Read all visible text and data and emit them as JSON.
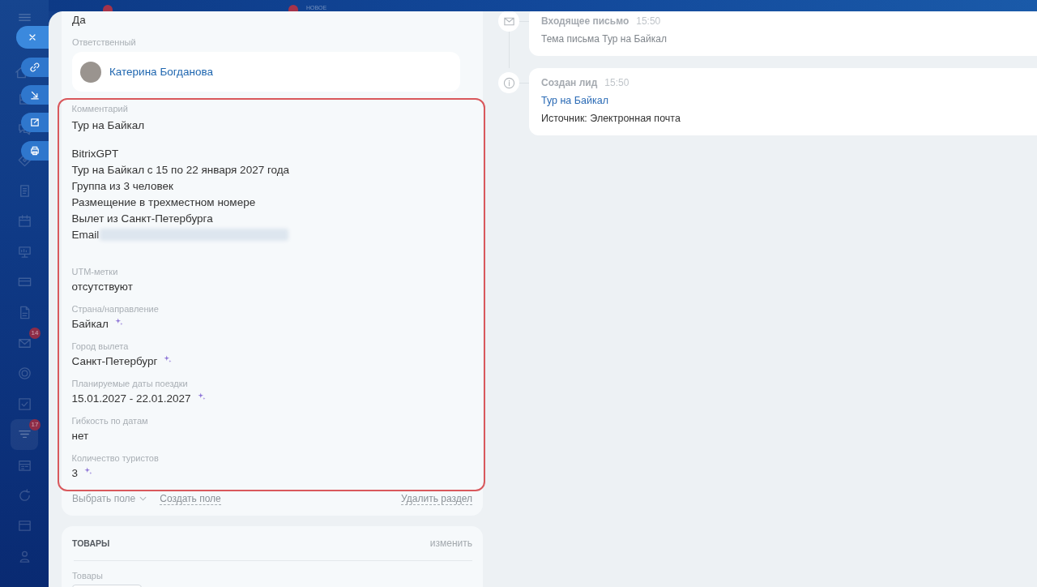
{
  "top_bar": {
    "label": "НОВОЕ"
  },
  "sidebar": {
    "items": [
      {
        "selected": false
      },
      {
        "selected": false
      },
      {
        "selected": false
      },
      {
        "selected": false
      },
      {
        "selected": false
      },
      {
        "selected": false
      },
      {
        "selected": false
      },
      {
        "selected": false
      },
      {
        "selected": false
      },
      {
        "selected": false,
        "badge": "14"
      },
      {
        "selected": false
      },
      {
        "selected": false
      },
      {
        "selected": true,
        "badge": "17"
      },
      {
        "selected": false
      },
      {
        "selected": false
      },
      {
        "selected": false
      },
      {
        "selected": false
      }
    ]
  },
  "lead_card": {
    "previous_value": "Да",
    "responsible": {
      "label": "Ответственный",
      "name": "Катерина Богданова"
    },
    "details": {
      "highlighted": true,
      "comment": {
        "label": "Комментарий",
        "paragraphs": [
          {
            "lines": [
              {
                "text": "Тур на Байкал",
                "redacted": false
              }
            ]
          },
          {
            "lines": [
              {
                "text": "BitrixGPT",
                "redacted": false
              },
              {
                "text": "Тур на Байкал с 15 по 22 января 2027 года",
                "redacted": false
              },
              {
                "text": "Группа из 3 человек",
                "redacted": false
              },
              {
                "text": "Размещение в трехместном номере",
                "redacted": false
              },
              {
                "text": "Вылет из Санкт-Петербурга",
                "redacted": false
              },
              {
                "text": "Email",
                "redacted": true
              }
            ]
          }
        ]
      },
      "fields": [
        {
          "label": "UTM-метки",
          "value": "отсутствуют",
          "ai_filled": false
        },
        {
          "label": "Страна/направление",
          "value": "Байкал",
          "ai_filled": true
        },
        {
          "label": "Город вылета",
          "value": "Санкт-Петербург",
          "ai_filled": true
        },
        {
          "label": "Планируемые даты поездки",
          "value": "15.01.2027 - 22.01.2027",
          "ai_filled": true
        },
        {
          "label": "Гибкость по датам",
          "value": "нет",
          "ai_filled": false
        },
        {
          "label": "Количество туристов",
          "value": "3",
          "ai_filled": true
        }
      ]
    },
    "footer": {
      "select_field": "Выбрать поле",
      "create_field": "Создать поле",
      "delete_section": "Удалить раздел"
    }
  },
  "products_card": {
    "title": "ТОВАРЫ",
    "edit": "изменить",
    "field_label": "Товары"
  },
  "timeline": [
    {
      "kind": "email",
      "title": "Входящее письмо",
      "time": "15:50",
      "lines": [
        {
          "kind": "muted",
          "text": "Тема письма Тур на Байкал"
        }
      ]
    },
    {
      "kind": "lead",
      "title": "Создан лид",
      "time": "15:50",
      "lines": [
        {
          "kind": "link",
          "text": "Тур на Байкал"
        },
        {
          "kind": "text",
          "text": "Источник: Электронная почта"
        }
      ]
    }
  ]
}
